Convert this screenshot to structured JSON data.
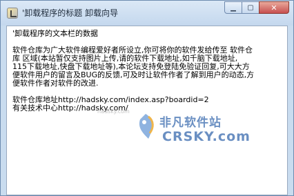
{
  "window": {
    "title": "'卸载程序的标题 卸载向导",
    "minimize_glyph": "▁",
    "maximize_glyph": "▢",
    "close_glyph": "✕"
  },
  "content": {
    "heading": "'卸载程序的文本栏的数据",
    "paragraph_lines": [
      "软件仓库为广大软件编程爱好者所设立,你可将你的软件发给传至 软件仓",
      "库 区域(本站暂仅支持图片上传,请的软件下载地址,如千脑下载地址,",
      "115下载地址,快盘下载地址等),本论坛支持免登陆免验证回复,可大大方",
      "便软件用户的留言及BUG的反馈,可及时让软件作者了解到用户的动态,方",
      "便软件作者对软件的改进."
    ],
    "repo_line": "软件仓库地址http://hadsky.com/index.asp?boardid=2",
    "support_line": "有关技术中心http://hadsky.com/"
  },
  "watermark": {
    "small_text": "hadsky.com",
    "title": "非凡软件站",
    "subtitle": "CRSKY.com"
  },
  "colors": {
    "titlebar": "#c9dcef",
    "close_button": "#c75050",
    "watermark": "#6a8fc2"
  }
}
